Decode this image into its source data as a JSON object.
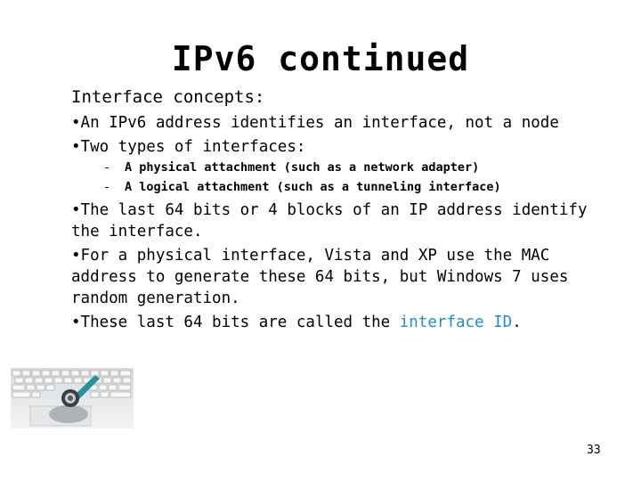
{
  "slide": {
    "title": "IPv6 continued",
    "heading": "Interface concepts:",
    "bullets": [
      {
        "text": "•An IPv6 address identifies an interface, not a node"
      },
      {
        "text": "•Two types of interfaces:"
      },
      {
        "text": "•The last 64 bits or 4 blocks of an IP address identify the interface."
      },
      {
        "text": "•For a physical interface, Vista and XP use the MAC address to generate these 64 bits, but Windows 7 uses random generation."
      },
      {
        "prefix": "•These last 64 bits are called the ",
        "highlight": "interface ID",
        "suffix": "."
      }
    ],
    "sub_items": [
      {
        "dash": "-",
        "text": "A physical attachment (such as a network adapter)"
      },
      {
        "dash": "-",
        "text": "A logical attachment (such as a tunneling interface)"
      }
    ],
    "image": {
      "icon": "laptop-stethoscope-photo"
    },
    "page_number": "33",
    "colors": {
      "highlight": "#1f8fc7",
      "text": "#000000",
      "background": "#ffffff"
    }
  }
}
